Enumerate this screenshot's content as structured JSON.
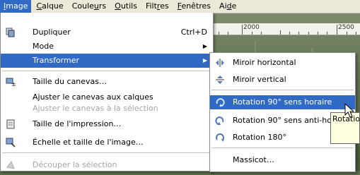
{
  "menubar": {
    "items": [
      {
        "label": "Image",
        "active": true
      },
      {
        "label": "Calque"
      },
      {
        "label": "Couleurs"
      },
      {
        "label": "Outils"
      },
      {
        "label": "Filtres"
      },
      {
        "label": "Fenêtres"
      },
      {
        "label": "Aide"
      }
    ]
  },
  "ruler": {
    "labels": [
      "2000",
      "2500"
    ]
  },
  "image_menu": {
    "items": [
      {
        "label": "Dupliquer",
        "shortcut": "Ctrl+D",
        "icon": "duplicate-icon"
      },
      {
        "label": "Mode",
        "submenu": true
      },
      {
        "label": "Transformer",
        "submenu": true,
        "highlighted": true
      },
      {
        "label": "Taille du canevas…",
        "icon": "canvas-size-icon"
      },
      {
        "label": "Ajuster le canevas aux calques"
      },
      {
        "label": "Ajuster le canevas à la sélection",
        "disabled": true
      },
      {
        "label": "Taille de l'impression…",
        "icon": "print-size-icon"
      },
      {
        "label": "Échelle et taille de l'image…",
        "icon": "scale-image-icon"
      },
      {
        "label": "Découper la sélection",
        "icon": "crop-icon",
        "disabled": true
      }
    ]
  },
  "transform_menu": {
    "items": [
      {
        "label": "Miroir horizontal",
        "icon": "flip-horizontal-icon"
      },
      {
        "label": "Miroir vertical",
        "icon": "flip-vertical-icon"
      },
      {
        "label": "Rotation 90° sens horaire",
        "icon": "rotate-cw-icon",
        "highlighted": true
      },
      {
        "label": "Rotation 90° sens anti-horaire",
        "icon": "rotate-ccw-icon"
      },
      {
        "label": "Rotation 180°",
        "icon": "rotate-180-icon"
      },
      {
        "label": "Massicot…"
      }
    ]
  },
  "tooltip": {
    "text": "Rotation"
  },
  "colors": {
    "highlight": "#316ac5",
    "menubar": "#ece9d8",
    "disabled": "#a7a6a0",
    "tooltip": "#ffffe1"
  }
}
